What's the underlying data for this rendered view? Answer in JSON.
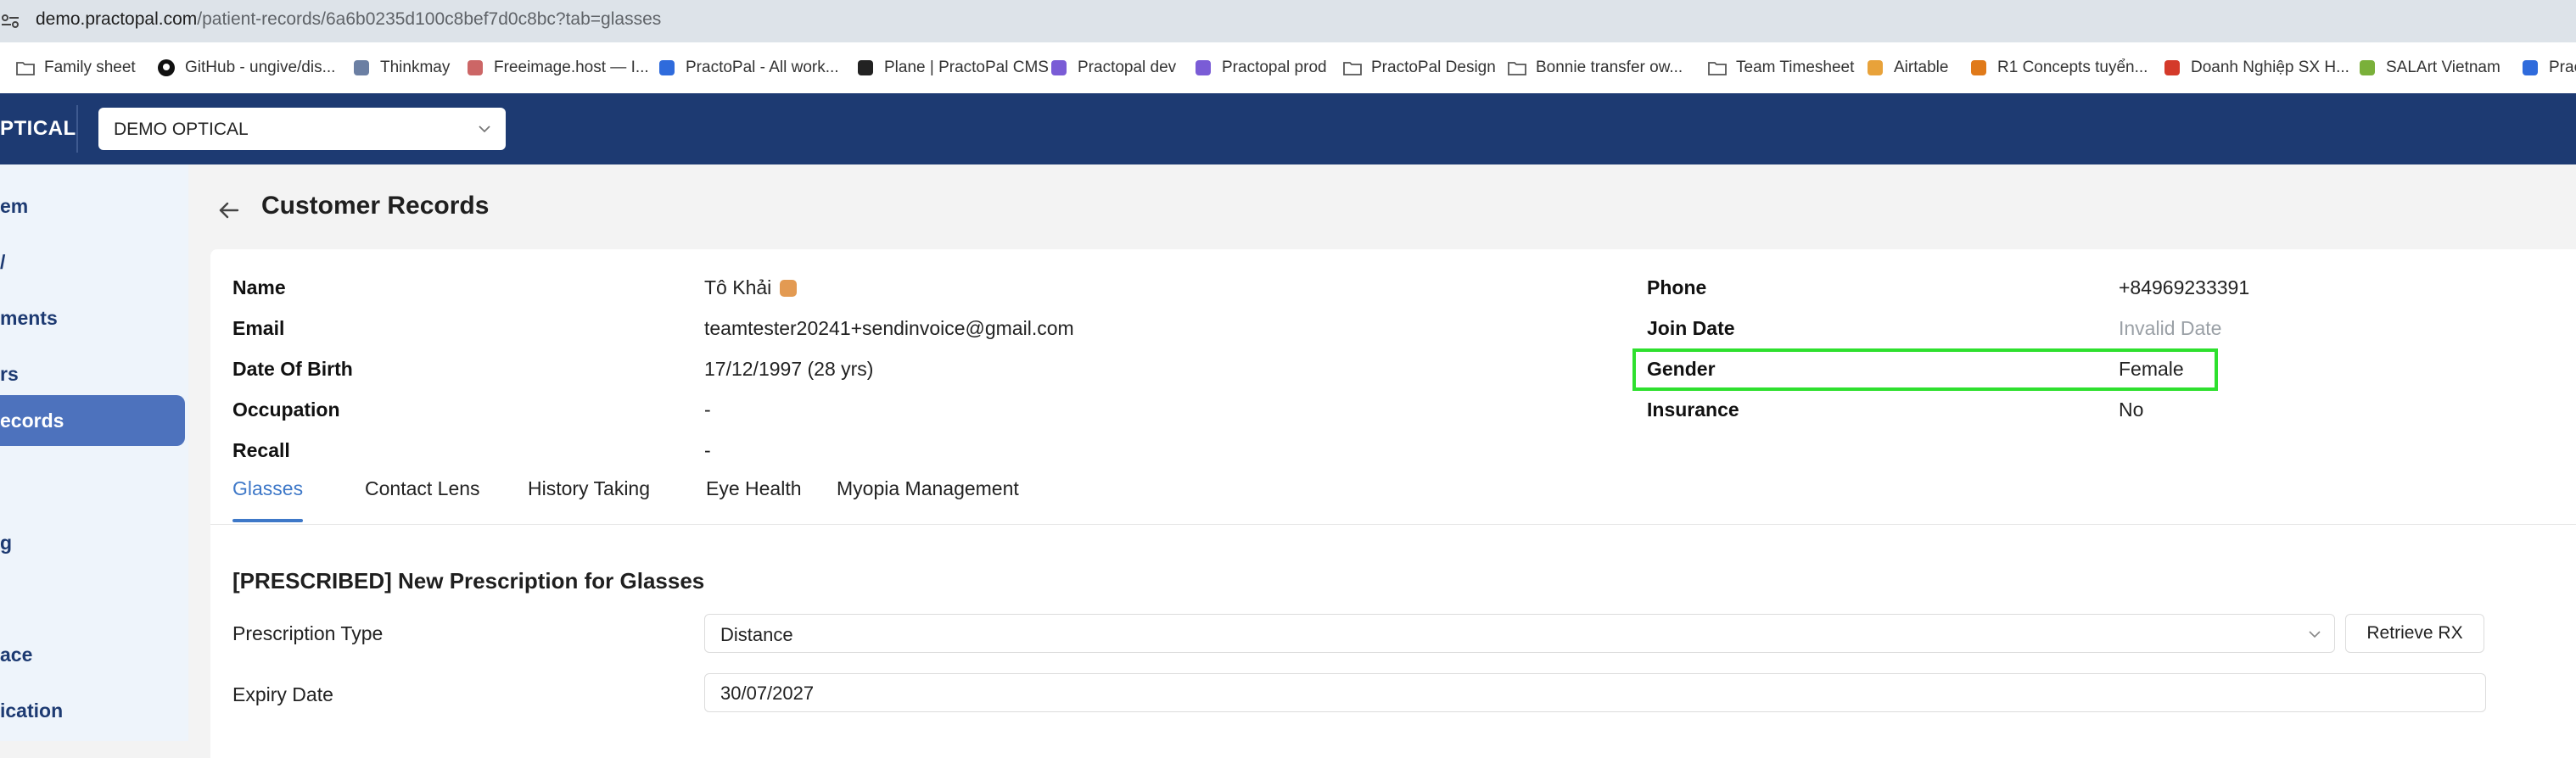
{
  "browser": {
    "url_host": "demo.practopal.com",
    "url_path": "/patient-records/6a6b0235d100c8bef7d0c8bc?tab=glasses",
    "bookmarks": [
      {
        "label": "Family sheet",
        "icon": "folder-icon"
      },
      {
        "label": "GitHub - ungive/dis...",
        "icon": "github-icon"
      },
      {
        "label": "Thinkmay",
        "icon": "thinkmay-icon"
      },
      {
        "label": "Freeimage.host — I...",
        "icon": "freeimage-icon"
      },
      {
        "label": "PractoPal - All work...",
        "icon": "practopal-icon"
      },
      {
        "label": "Plane | PractoPal CMS",
        "icon": "plane-icon"
      },
      {
        "label": "Practopal dev",
        "icon": "practopal-dev-icon"
      },
      {
        "label": "Practopal prod",
        "icon": "practopal-prod-icon"
      },
      {
        "label": "PractoPal Design",
        "icon": "folder-icon"
      },
      {
        "label": "Bonnie transfer ow...",
        "icon": "folder-icon"
      },
      {
        "label": "Team Timesheet",
        "icon": "folder-icon"
      },
      {
        "label": "Airtable",
        "icon": "airtable-icon"
      },
      {
        "label": "R1 Concepts tuyển...",
        "icon": "r1-icon"
      },
      {
        "label": "Doanh Nghiệp SX H...",
        "icon": "doanhnghiep-icon"
      },
      {
        "label": "SALArt Vietnam",
        "icon": "salart-icon"
      },
      {
        "label": "Prac",
        "icon": "prac-icon"
      }
    ]
  },
  "header": {
    "brand_fragment": "PTICAL",
    "org_select_value": "DEMO OPTICAL"
  },
  "sidebar": {
    "items": [
      {
        "label": "em"
      },
      {
        "label": "/"
      },
      {
        "label": "ments"
      },
      {
        "label": "rs"
      },
      {
        "label": "ecords",
        "active": true
      },
      {
        "label": "g"
      },
      {
        "label": "ace"
      },
      {
        "label": "ication"
      }
    ]
  },
  "page": {
    "title": "Customer Records"
  },
  "patient": {
    "name_label": "Name",
    "name_value": "Tô Khải",
    "email_label": "Email",
    "email_value": "teamtester20241+sendinvoice@gmail.com",
    "dob_label": "Date Of Birth",
    "dob_value": "17/12/1997 (28 yrs)",
    "occupation_label": "Occupation",
    "occupation_value": "-",
    "recall_label": "Recall",
    "recall_value": "-",
    "phone_label": "Phone",
    "phone_value": "+84969233391",
    "join_date_label": "Join Date",
    "join_date_value": "Invalid Date",
    "gender_label": "Gender",
    "gender_value": "Female",
    "insurance_label": "Insurance",
    "insurance_value": "No"
  },
  "tabs": [
    {
      "label": "Glasses",
      "active": true
    },
    {
      "label": "Contact Lens"
    },
    {
      "label": "History Taking"
    },
    {
      "label": "Eye Health"
    },
    {
      "label": "Myopia Management"
    }
  ],
  "prescription": {
    "section_title": "[PRESCRIBED] New Prescription for Glasses",
    "type_label": "Prescription Type",
    "type_value": "Distance",
    "retrieve_label": "Retrieve RX",
    "expiry_label": "Expiry Date",
    "expiry_value": "30/07/2027"
  },
  "colors": {
    "header_bg": "#1d3a72",
    "sidebar_active": "#4d72bd",
    "tab_active": "#3e78c8",
    "highlight": "#2ee02e",
    "tag": "#e39a52"
  }
}
